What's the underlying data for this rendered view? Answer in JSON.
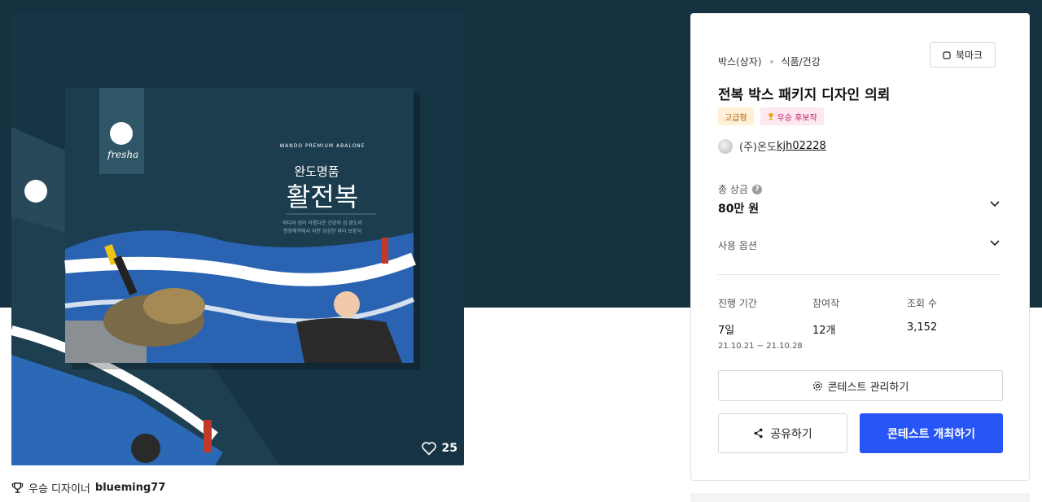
{
  "artwork": {
    "brand": "fresha",
    "box_en": "WANDO PREMIUM ABALONE",
    "box_sub": "완도명품",
    "box_title": "활전복",
    "box_copy_1": "바다와 섬이 아름다운 건강의 섬 완도의",
    "box_copy_2": "청정해역에서 자란 싱싱한 바다 보양식",
    "likes": "25"
  },
  "winner": {
    "prefix": "우승 디자이너",
    "name": "blueming77"
  },
  "panel": {
    "category": "박스(상자)",
    "subcategory": "식품/건강",
    "bookmark_label": "북마크",
    "title": "전복 박스 패키지 디자인 의뢰",
    "badges": [
      "고급형",
      "우승 후보작"
    ],
    "host_name": "(주)온도",
    "host_id": "kjh02228",
    "prize_label": "총 상금",
    "prize_value": "80만 원",
    "options_label": "사용 옵션",
    "stats": [
      {
        "label": "진행 기간",
        "value": "7일",
        "detail": "21.10.21 ~ 21.10.28"
      },
      {
        "label": "참여작",
        "value": "12개",
        "detail": ""
      },
      {
        "label": "조회 수",
        "value": "3,152",
        "detail": ""
      }
    ],
    "manage_label": "콘테스트 관리하기",
    "share_label": "공유하기",
    "host_contest_label": "콘테스트 개최하기"
  },
  "colors": {
    "hero_bg": "#163140",
    "primary": "#2855f5",
    "tier_badge": "#fff0d6",
    "winner_badge": "#fde8f0"
  }
}
